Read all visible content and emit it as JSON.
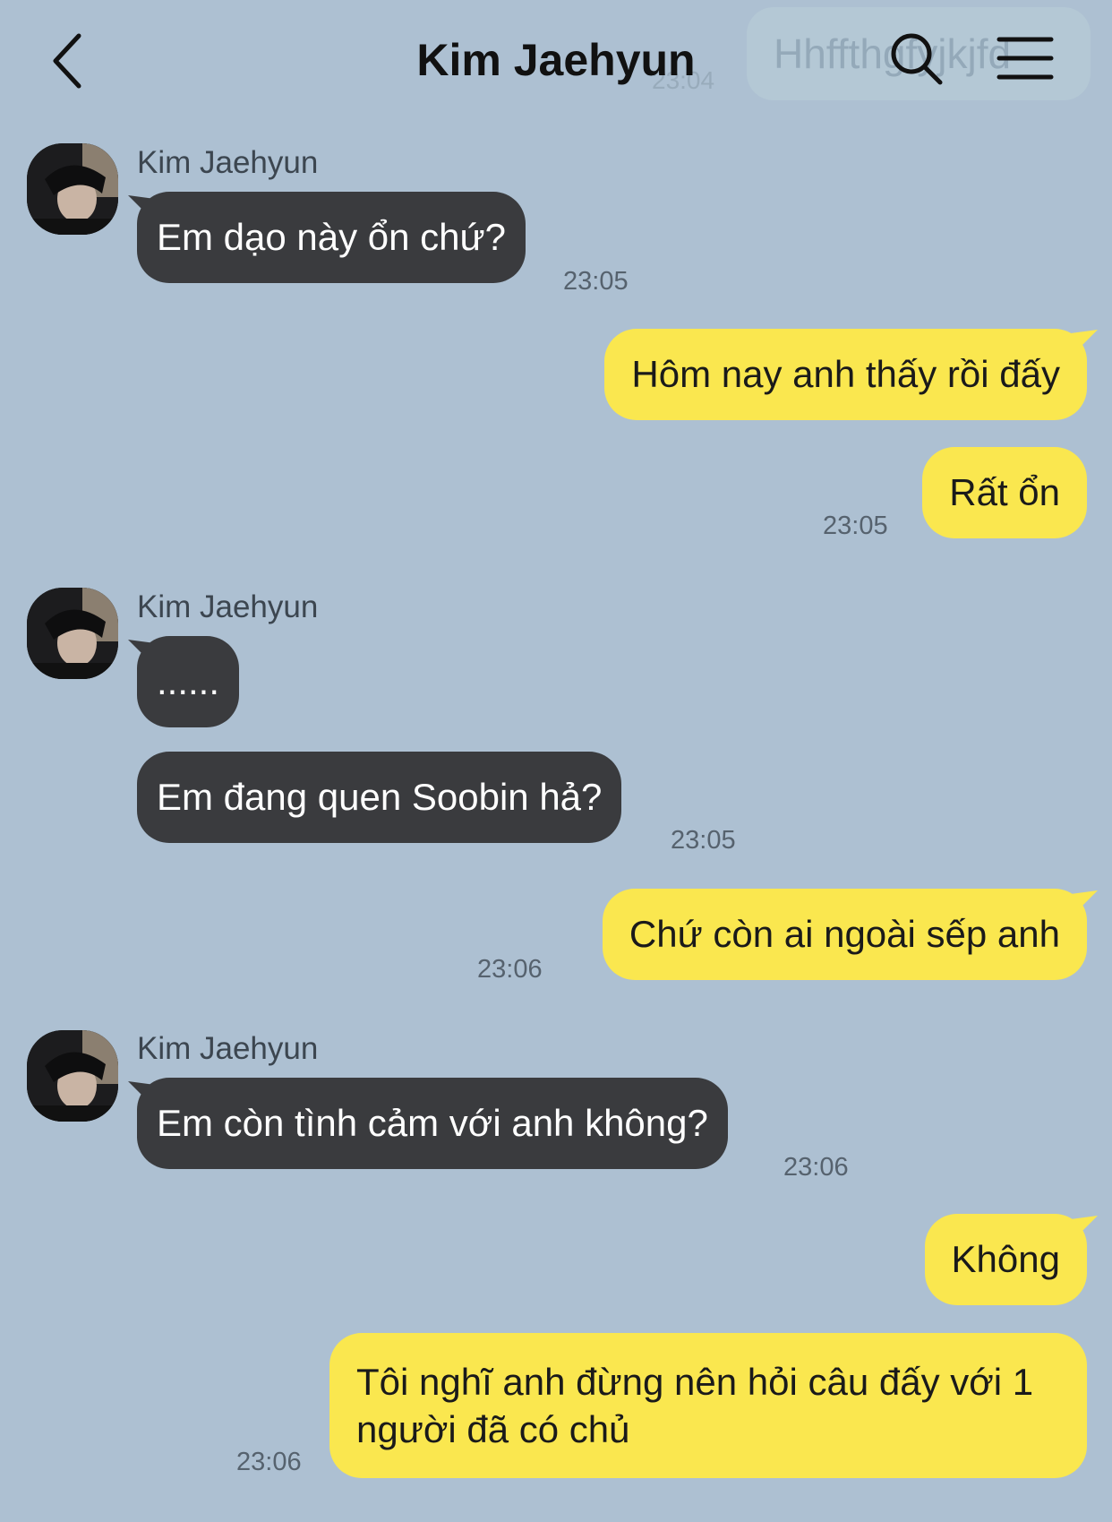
{
  "header": {
    "title": "Kim Jaehyun",
    "ghost_message": "Hhffthgfyjkjfd",
    "ghost_time": "23:04"
  },
  "messages": {
    "g1": {
      "sender": "Kim Jaehyun",
      "text": "Em dạo này ổn chứ?",
      "time": "23:05"
    },
    "m2": {
      "text": "Hôm nay anh thấy rồi đấy"
    },
    "m3": {
      "text": "Rất ổn",
      "time": "23:05"
    },
    "g2": {
      "sender": "Kim Jaehyun",
      "text1": "......",
      "text2": "Em đang quen Soobin hả?",
      "time": "23:05"
    },
    "m5": {
      "text": "Chứ còn ai ngoài sếp anh",
      "time": "23:06"
    },
    "g3": {
      "sender": "Kim Jaehyun",
      "text": "Em còn tình cảm với anh không?",
      "time": "23:06"
    },
    "m7": {
      "text": "Không"
    },
    "m8": {
      "text": "Tôi nghĩ anh đừng nên hỏi câu đấy với 1 người đã có chủ",
      "time": "23:06"
    }
  },
  "colors": {
    "background": "#adc0d2",
    "incoming_bubble": "#3a3b3e",
    "outgoing_bubble": "#fae74f"
  },
  "icons": [
    "back-icon",
    "search-icon",
    "menu-icon"
  ]
}
